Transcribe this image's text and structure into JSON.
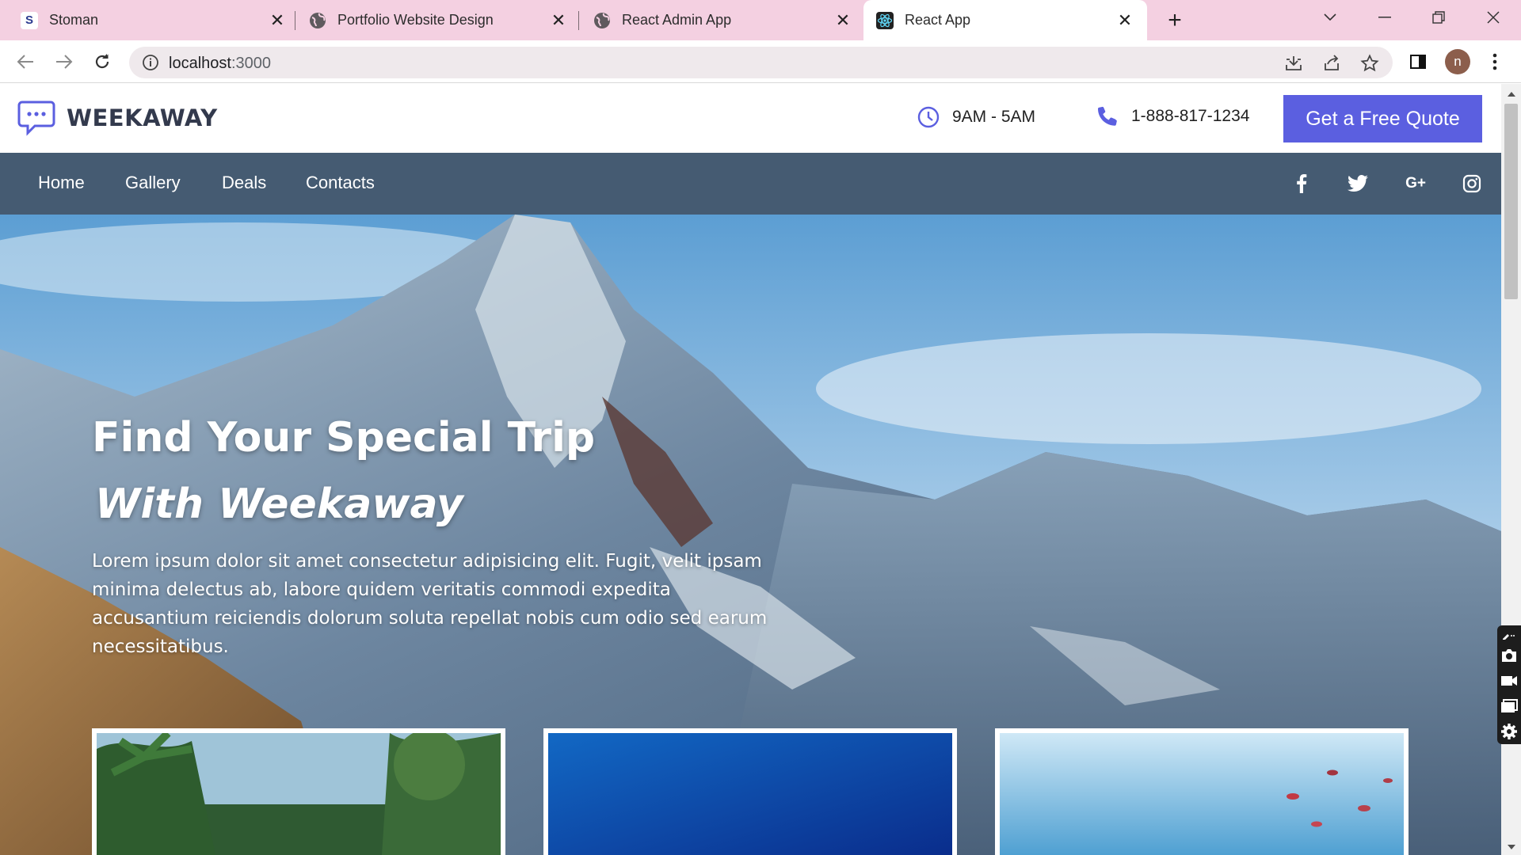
{
  "browser": {
    "tabs": [
      {
        "title": "Stoman",
        "favicon": "s-letter-icon"
      },
      {
        "title": "Portfolio Website Design",
        "favicon": "globe-icon"
      },
      {
        "title": "React Admin App",
        "favicon": "globe-icon"
      },
      {
        "title": "React App",
        "favicon": "react-icon",
        "active": true
      }
    ],
    "url_host": "localhost",
    "url_port": ":3000",
    "profile_initial": "n",
    "tabbar_color": "#f4d0e1"
  },
  "site": {
    "brand": "WEEKAWAY",
    "hours": "9AM - 5AM",
    "phone": "1-888-817-1234",
    "cta": "Get a Free Quote",
    "accent_color": "#5b5fe0",
    "nav_color": "#455b72",
    "nav": [
      "Home",
      "Gallery",
      "Deals",
      "Contacts"
    ],
    "social": [
      "facebook-icon",
      "twitter-icon",
      "google-plus-icon",
      "instagram-icon"
    ],
    "google_plus_label": "G+",
    "hero": {
      "title_line1": "Find Your Special Trip",
      "title_line2": "With Weekaway",
      "text": "Lorem ipsum dolor sit amet consectetur adipisicing elit. Fugit, velit ipsam minima delectus ab, labore quidem veritatis commodi expedita accusantium reiciendis dolorum soluta repellat nobis cum odio sed earum necessitatibus."
    }
  }
}
